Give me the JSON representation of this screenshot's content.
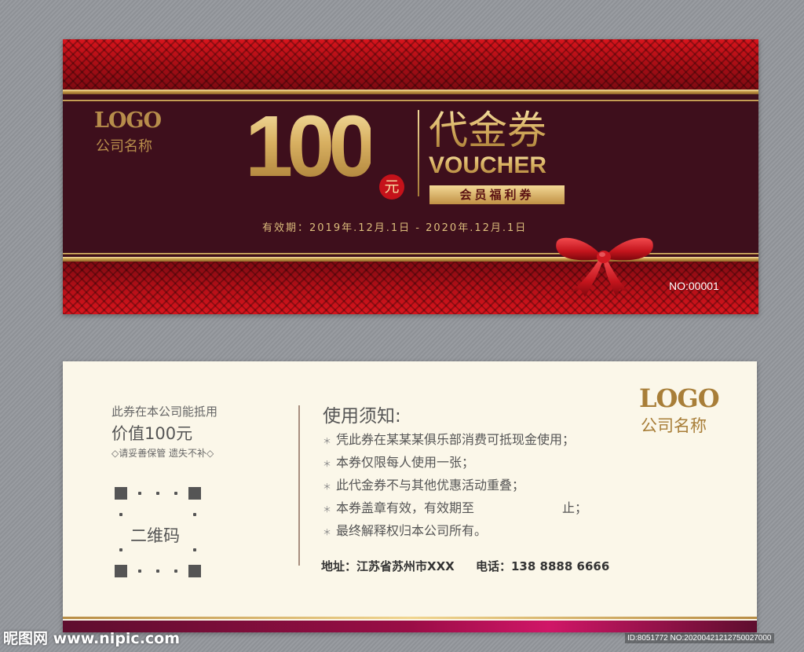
{
  "front": {
    "logo": "LOGO",
    "company": "公司名称",
    "amount": "100",
    "currency": "元",
    "title_cn": "代金券",
    "title_en": "VOUCHER",
    "subtitle": "会员福利券",
    "validity": "有效期：2019年.12月.1日 - 2020年.12月.1日",
    "serial": "NO:00001"
  },
  "back": {
    "redeem": "此券在本公司能抵用",
    "value": "价值100元",
    "keep": "◇请妥善保管 遗失不补◇",
    "qr_label": "二维码",
    "notice_title": "使用须知:",
    "bullet": "＊",
    "notices": [
      "凭此券在某某某俱乐部消费可抵现金使用；",
      "本券仅限每人使用一张；",
      "此代金券不与其他优惠活动重叠；",
      "本券盖章有效，有效期至",
      "最终解释权归本公司所有。"
    ],
    "notice_after": "止；",
    "address": "地址：江苏省苏州市XXX",
    "phone": "电话：138 8888 6666",
    "logo": "LOGO",
    "company": "公司名称"
  },
  "watermark": {
    "left": "昵图网 www.nipic.com",
    "right": "ID:8051772 NO:20200421212750027000"
  },
  "colors": {
    "maroon": "#3e0f1c",
    "red": "#c5121a",
    "gold": "#d8b061",
    "cream": "#fbf7e9",
    "magenta": "#d01667"
  }
}
